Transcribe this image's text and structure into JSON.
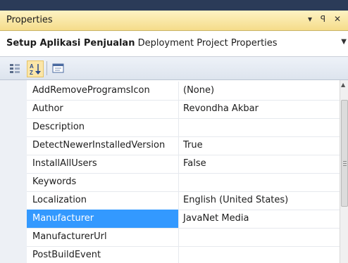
{
  "window": {
    "title": "Properties",
    "controls": [
      "▾",
      "ꟼ",
      "✕"
    ]
  },
  "object_selector": {
    "object_name": "Setup Aplikasi Penjualan",
    "object_type": "Deployment Project Properties"
  },
  "toolbar": {
    "icons": [
      "categorized-icon",
      "alphabetical-icon",
      "property-pages-icon"
    ]
  },
  "properties": [
    {
      "name": "AddRemoveProgramsIcon",
      "value": "(None)"
    },
    {
      "name": "Author",
      "value": "Revondha Akbar"
    },
    {
      "name": "Description",
      "value": ""
    },
    {
      "name": "DetectNewerInstalledVersion",
      "value": "True"
    },
    {
      "name": "InstallAllUsers",
      "value": "False"
    },
    {
      "name": "Keywords",
      "value": ""
    },
    {
      "name": "Localization",
      "value": "English (United States)"
    },
    {
      "name": "Manufacturer",
      "value": "JavaNet Media",
      "selected": true
    },
    {
      "name": "ManufacturerUrl",
      "value": ""
    },
    {
      "name": "PostBuildEvent",
      "value": ""
    }
  ],
  "colors": {
    "selection": "#3399ff",
    "title_gradient_top": "#fdf3c4",
    "title_gradient_bottom": "#f5dc8a",
    "frame": "#2b3b58"
  }
}
